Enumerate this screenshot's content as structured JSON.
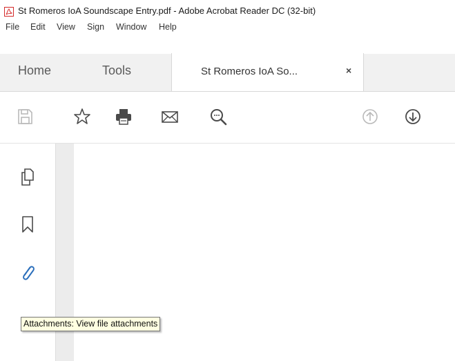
{
  "window": {
    "title": "St Romeros IoA Soundscape Entry.pdf - Adobe Acrobat Reader DC (32-bit)"
  },
  "menu": {
    "items": [
      "File",
      "Edit",
      "View",
      "Sign",
      "Window",
      "Help"
    ]
  },
  "tabs": {
    "home": "Home",
    "tools": "Tools",
    "document": "St Romeros IoA So...",
    "close_glyph": "×"
  },
  "toolbar": {
    "icons": [
      "save-icon",
      "bookmark-star-icon",
      "print-icon",
      "email-icon",
      "zoom-icon",
      "page-up-icon",
      "page-down-icon"
    ]
  },
  "sidebar": {
    "icons": [
      "pages-icon",
      "bookmark-icon",
      "attachment-icon"
    ],
    "accent_color": "#2a6ebb"
  },
  "tooltip": {
    "text": "Attachments: View file attachments"
  }
}
